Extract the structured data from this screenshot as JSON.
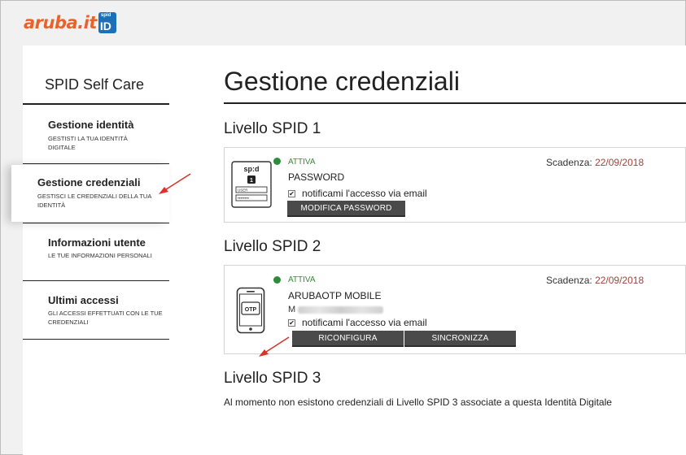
{
  "header": {
    "logo_text": "aruba.it",
    "logo_badge_top": "spid",
    "logo_badge_main": "ID"
  },
  "sidebar": {
    "title": "SPID Self Care",
    "items": [
      {
        "label": "Gestione identità",
        "sub": "GESTISTI LA TUA IDENTITÀ DIGITALE"
      },
      {
        "label": "Gestione credenziali",
        "sub": "GESTISCI LE CREDENZIALI DELLA TUA IDENTITÀ",
        "active": true
      },
      {
        "label": "Informazioni utente",
        "sub": "LE TUE INFORMAZIONI PERSONALI"
      },
      {
        "label": "Ultimi accessi",
        "sub": "GLI ACCESSI EFFETTUATI CON LE TUE CREDENZIALI"
      }
    ]
  },
  "main": {
    "title": "Gestione credenziali",
    "levels": [
      {
        "title": "Livello SPID 1",
        "status": "ATTIVA",
        "name": "PASSWORD",
        "expiry_label": "Scadenza:",
        "expiry_date": "22/09/2018",
        "notify_label": "notificami l'accesso via email",
        "buttons": [
          "MODIFICA PASSWORD"
        ],
        "icon": {
          "top": "sp:d",
          "badge": "1",
          "user_field": "USER",
          "pass_field": "••••••••"
        }
      },
      {
        "title": "Livello SPID 2",
        "status": "ATTIVA",
        "name": "ARUBAOTP MOBILE",
        "masked_prefix": "M",
        "expiry_label": "Scadenza:",
        "expiry_date": "22/09/2018",
        "notify_label": "notificami l'accesso via email",
        "buttons": [
          "RICONFIGURA",
          "SINCRONIZZA"
        ],
        "icon": {
          "label": "OTP"
        }
      },
      {
        "title": "Livello SPID 3",
        "message": "Al momento non esistono credenziali di Livello SPID 3 associate a questa Identità Digitale"
      }
    ]
  },
  "colors": {
    "brand_orange": "#e8632c",
    "brand_blue": "#1d6fb8",
    "status_green": "#2e8b3a",
    "date_red": "#a0433a",
    "button_dark": "#4a4a4a",
    "annotation_arrow": "#d9332b"
  }
}
